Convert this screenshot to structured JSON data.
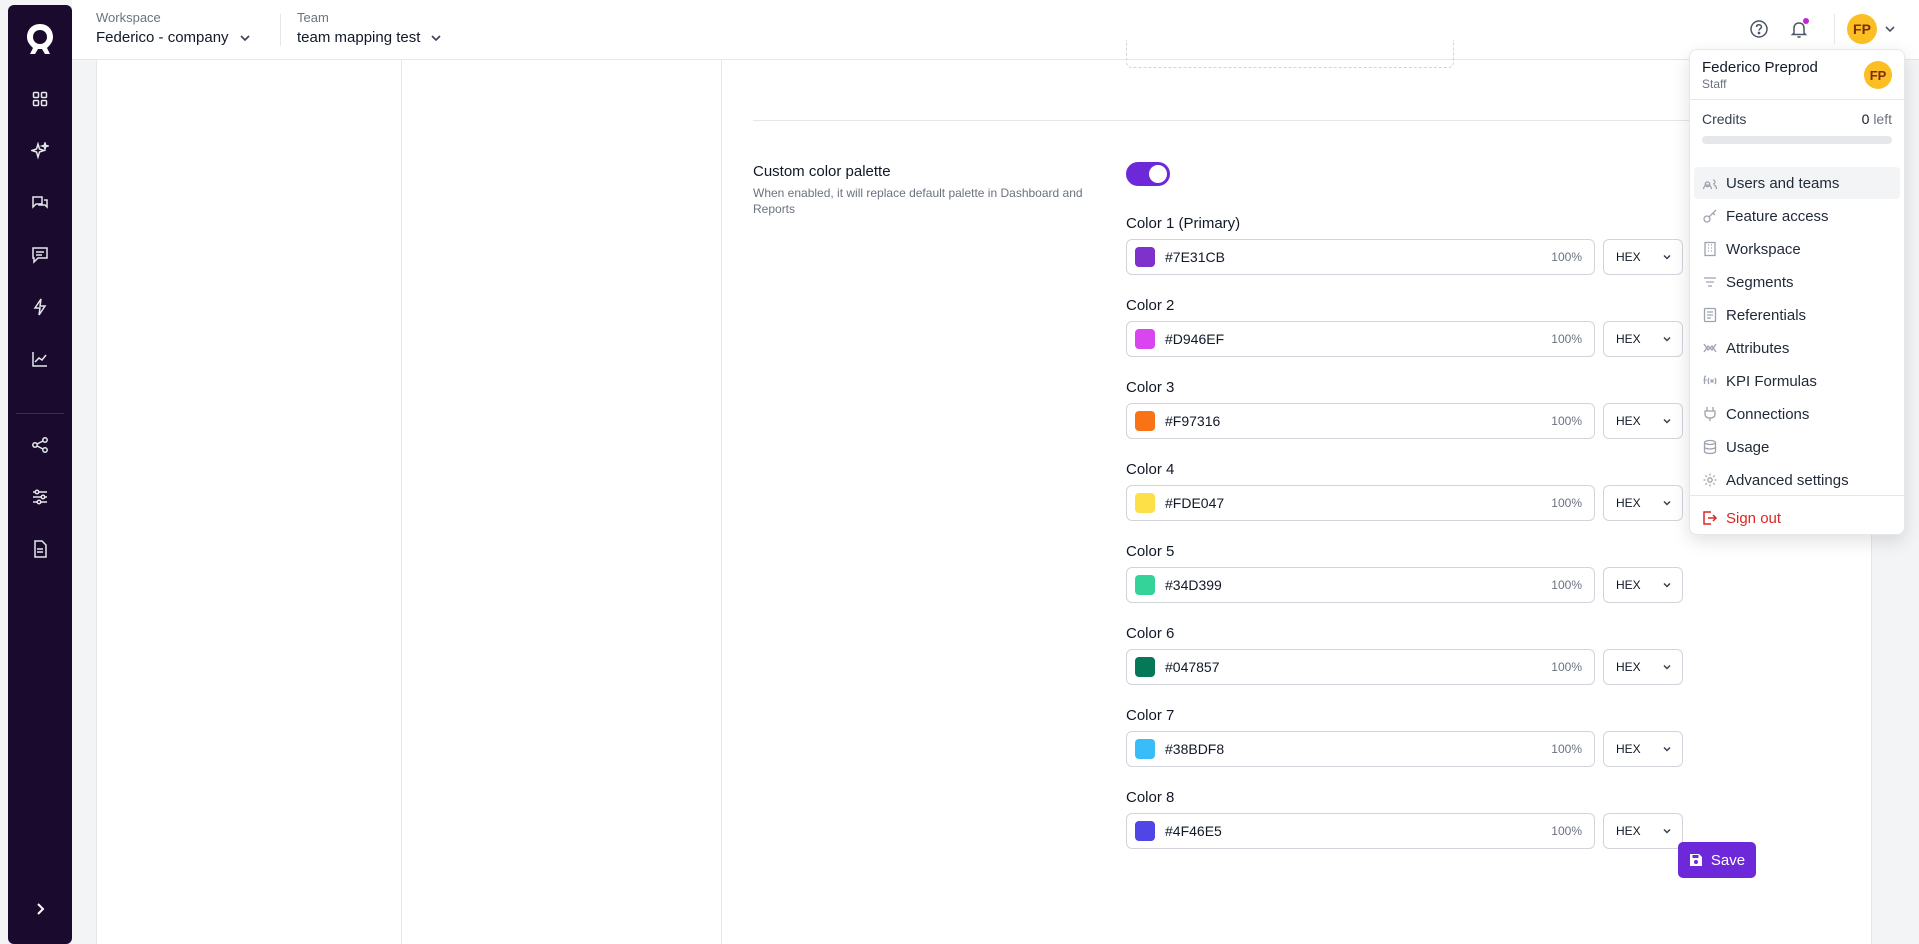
{
  "header": {
    "workspace": {
      "label": "Workspace",
      "value": "Federico - company"
    },
    "team": {
      "label": "Team",
      "value": "team mapping test"
    },
    "avatar_initials": "FP"
  },
  "rail": {
    "icons": [
      "logo-icon",
      "dashboard-icon",
      "sparkles-icon",
      "chat-icon",
      "message-icon",
      "lightning-icon",
      "chart-icon",
      "share-icon",
      "sliders-icon",
      "document-icon",
      "chevron-right-icon"
    ]
  },
  "palette": {
    "title": "Custom color palette",
    "description": "When enabled, it will replace default palette in Dashboard and Reports",
    "enabled": true,
    "colors": [
      {
        "label": "Color 1 (Primary)",
        "hex": "#7E31CB",
        "opacity": "100%",
        "format": "HEX"
      },
      {
        "label": "Color 2",
        "hex": "#D946EF",
        "opacity": "100%",
        "format": "HEX"
      },
      {
        "label": "Color 3",
        "hex": "#F97316",
        "opacity": "100%",
        "format": "HEX"
      },
      {
        "label": "Color 4",
        "hex": "#FDE047",
        "opacity": "100%",
        "format": "HEX"
      },
      {
        "label": "Color 5",
        "hex": "#34D399",
        "opacity": "100%",
        "format": "HEX"
      },
      {
        "label": "Color 6",
        "hex": "#047857",
        "opacity": "100%",
        "format": "HEX"
      },
      {
        "label": "Color 7",
        "hex": "#38BDF8",
        "opacity": "100%",
        "format": "HEX"
      },
      {
        "label": "Color 8",
        "hex": "#4F46E5",
        "opacity": "100%",
        "format": "HEX"
      }
    ]
  },
  "save_label": "Save",
  "menu": {
    "user_name": "Federico Preprod",
    "user_role": "Staff",
    "avatar_initials": "FP",
    "credits_label": "Credits",
    "credits_value": "0",
    "credits_suffix": "left",
    "credits_fraction": 0,
    "items": [
      {
        "label": "Users and teams",
        "icon": "users-icon"
      },
      {
        "label": "Feature access",
        "icon": "key-icon"
      },
      {
        "label": "Workspace",
        "icon": "building-icon"
      },
      {
        "label": "Segments",
        "icon": "filter-icon"
      },
      {
        "label": "Referentials",
        "icon": "list-icon"
      },
      {
        "label": "Attributes",
        "icon": "attributes-icon"
      },
      {
        "label": "KPI Formulas",
        "icon": "formula-icon"
      },
      {
        "label": "Connections",
        "icon": "plug-icon"
      },
      {
        "label": "Usage",
        "icon": "database-icon"
      },
      {
        "label": "Advanced settings",
        "icon": "gear-icon"
      }
    ],
    "sign_out": "Sign out"
  },
  "colors": {
    "accent": "#6d28d9",
    "rail": "#1a0b2e",
    "danger": "#dc2626"
  }
}
